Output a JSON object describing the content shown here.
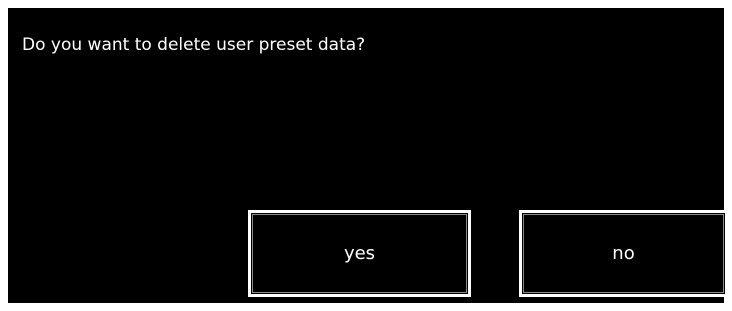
{
  "dialog": {
    "message": "Do you want to delete user preset data?",
    "yes_label": "yes",
    "no_label": "no"
  },
  "colors": {
    "background": "#000000",
    "text": "#ffffff",
    "button_border": "#ffffff"
  }
}
